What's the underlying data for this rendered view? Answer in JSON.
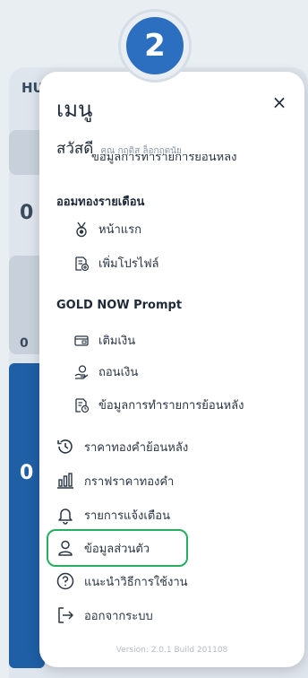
{
  "background": {
    "brand": "HU",
    "digits": [
      "0",
      "0",
      "0"
    ]
  },
  "step_badge": "2",
  "menu": {
    "title": "เมนู",
    "close": "×",
    "greeting": "สวัสดี",
    "user_name": "คุณ กฤดิส ล็อกฤตนัย",
    "clipped_item": "ข้อมูลการทำรายการย้อนหลัง",
    "section_savings": "ออมทองรายเดือน",
    "savings_items": [
      "หน้าแรก",
      "เพิ่มโปรไฟล์"
    ],
    "section_goldnow": "GOLD NOW Prompt",
    "goldnow_items": [
      "เติมเงิน",
      "ถอนเงิน",
      "ข้อมูลการทำรายการย้อนหลัง"
    ],
    "main_items": [
      "ราคาทองคำย้อนหลัง",
      "กราฟราคาทองคำ",
      "รายการแจ้งเตือน",
      "ข้อมูลส่วนตัว",
      "แนะนำวิธีการใช้งาน",
      "ออกจากระบบ"
    ],
    "version": "Version: 2.0.1 Build 201108"
  },
  "colors": {
    "accent_blue": "#2c6fc1",
    "highlight_green": "#27ae60"
  }
}
